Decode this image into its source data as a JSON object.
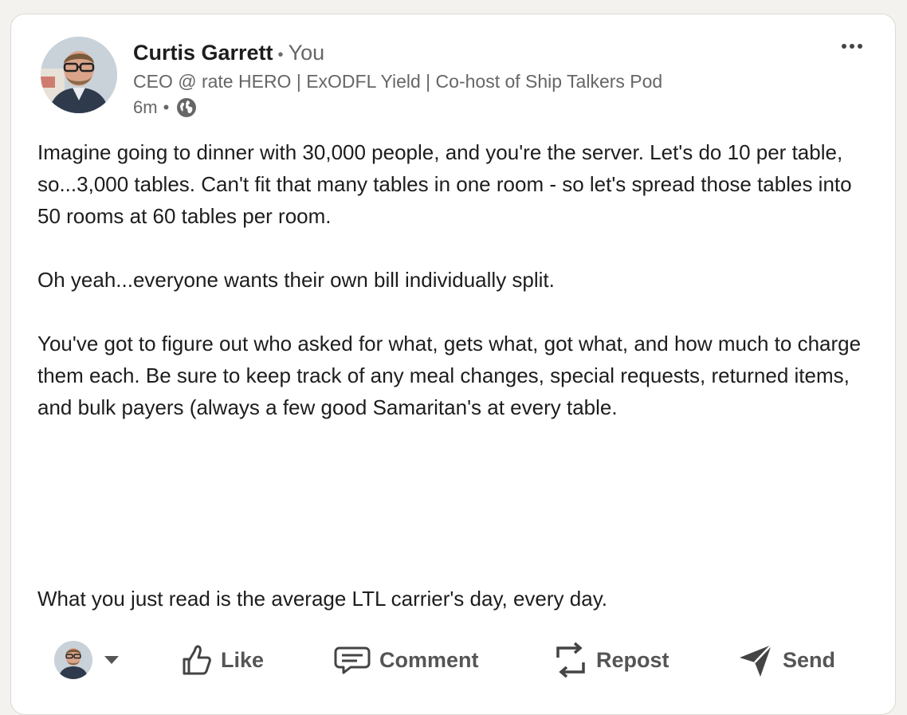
{
  "post": {
    "author": {
      "name": "Curtis Garrett",
      "separator": "•",
      "relation": "You",
      "headline": "CEO @ rate HERO | ExODFL Yield | Co-host of Ship Talkers Pod",
      "time": "6m",
      "time_separator": "•",
      "visibility_icon": "globe-icon"
    },
    "more_icon": "more-options-icon",
    "body": {
      "p1": "Imagine going to dinner with 30,000 people, and you're the server. Let's do 10 per table, so...3,000 tables. Can't fit that many tables in one room - so let's spread those tables into 50 rooms at 60 tables per room.",
      "p2": "Oh yeah...everyone wants their own bill individually split.",
      "p3": "You've got to figure out who asked for what, gets what, got what, and how much to charge them each. Be sure to keep track of any meal changes, special requests, returned items, and bulk payers (always a few good Samaritan's at every table.",
      "p4": "What you just read is the average LTL carrier's day, every day."
    }
  },
  "actions": {
    "like": "Like",
    "comment": "Comment",
    "repost": "Repost",
    "send": "Send"
  },
  "colors": {
    "page_bg": "#f4f2ee",
    "card_bg": "#ffffff",
    "text": "#1d1d1d",
    "muted": "#666666",
    "action": "#555555"
  }
}
